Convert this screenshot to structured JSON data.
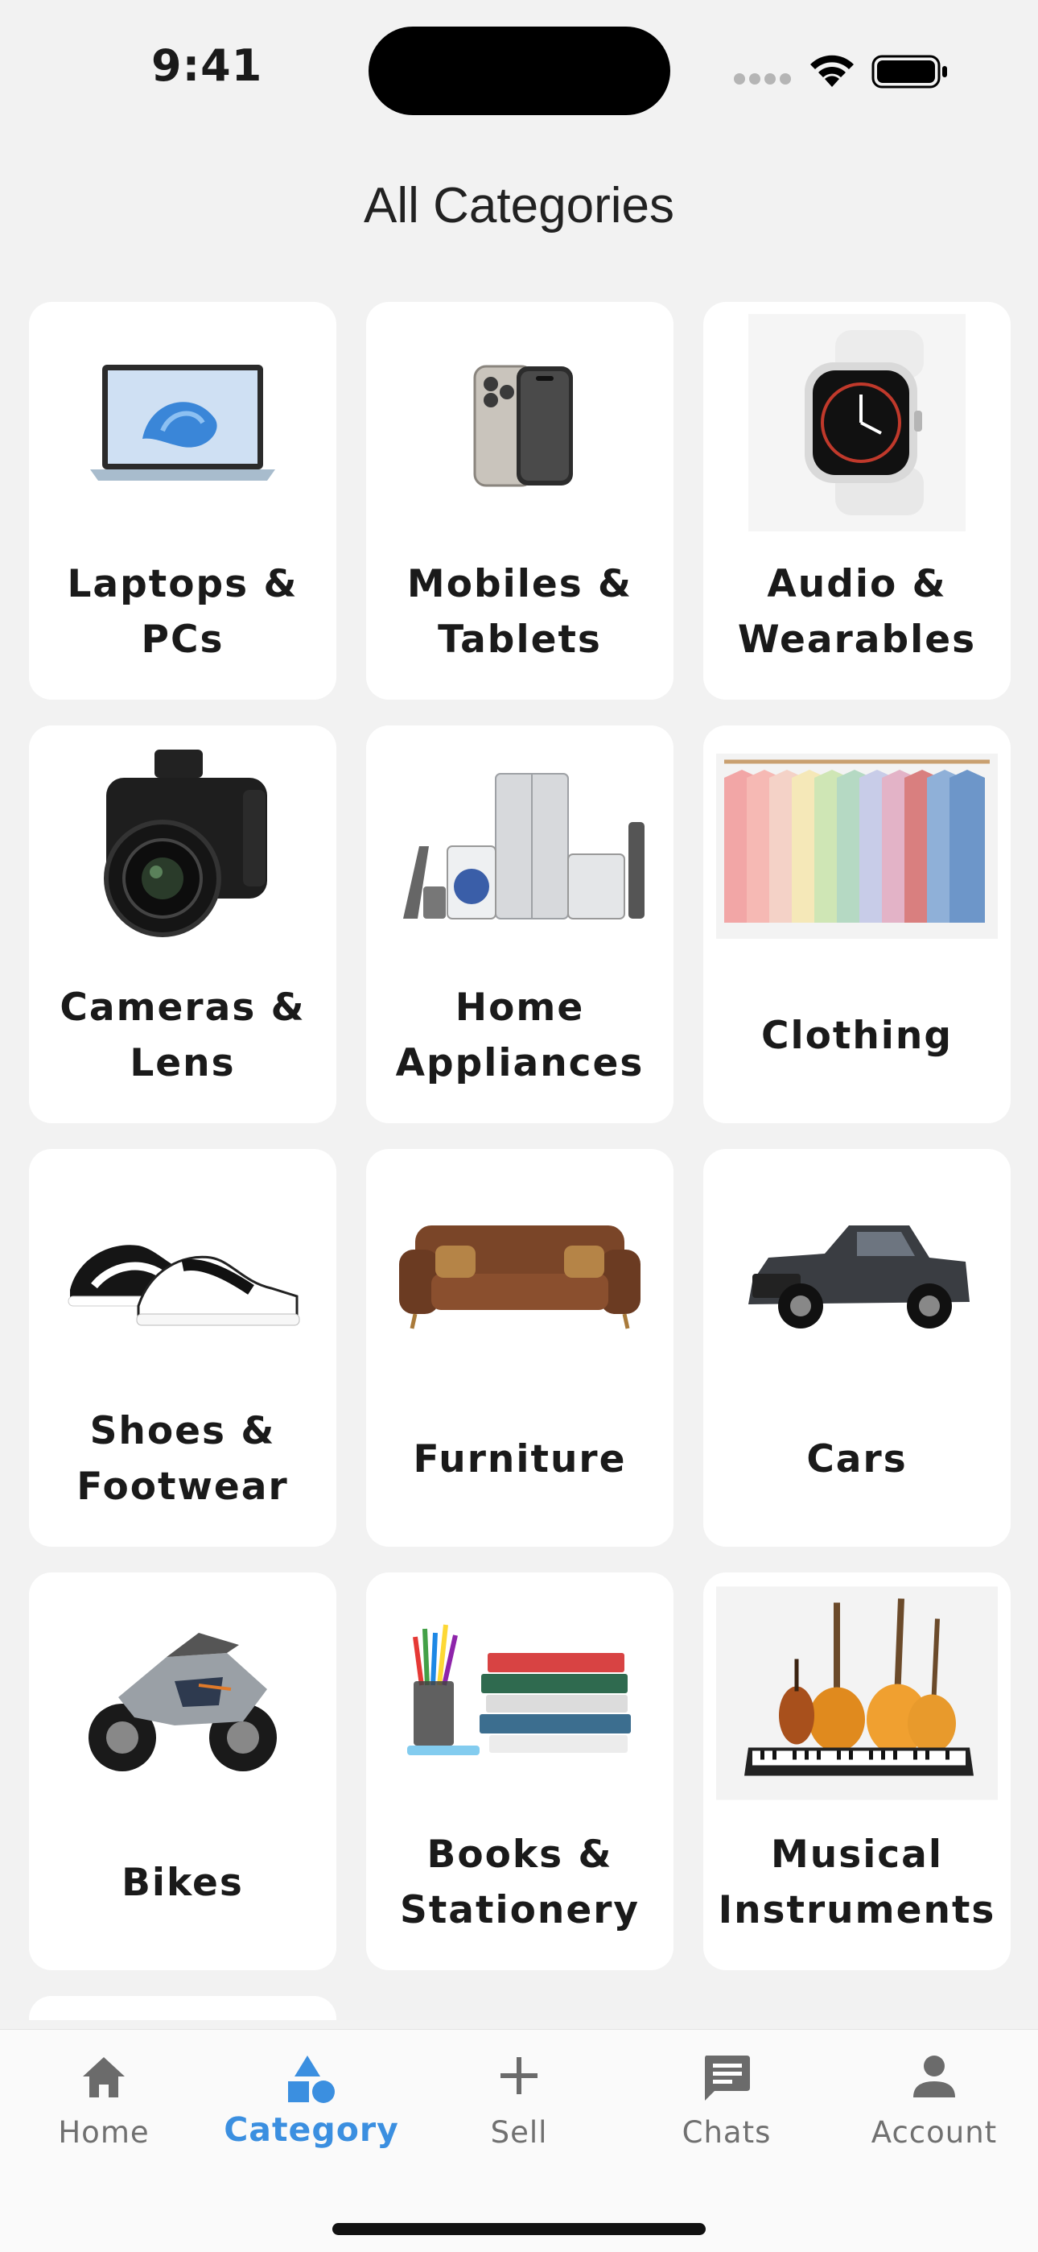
{
  "status_bar": {
    "time": "9:41"
  },
  "header": {
    "title": "All Categories"
  },
  "categories": [
    {
      "label": "Laptops &\nPCs",
      "icon": "laptop-icon"
    },
    {
      "label": "Mobiles &\nTablets",
      "icon": "smartphone-icon"
    },
    {
      "label": "Audio &\nWearables",
      "icon": "smartwatch-icon"
    },
    {
      "label": "Cameras &\nLens",
      "icon": "camera-icon"
    },
    {
      "label": "Home\nAppliances",
      "icon": "appliances-icon"
    },
    {
      "label": "Clothing",
      "icon": "clothing-rack-icon"
    },
    {
      "label": "Shoes &\nFootwear",
      "icon": "sneakers-icon"
    },
    {
      "label": "Furniture",
      "icon": "sofa-icon"
    },
    {
      "label": "Cars",
      "icon": "pickup-truck-icon"
    },
    {
      "label": "Bikes",
      "icon": "motorcycle-icon"
    },
    {
      "label": "Books &\nStationery",
      "icon": "books-icon"
    },
    {
      "label": "Musical\nInstruments",
      "icon": "instruments-icon"
    }
  ],
  "tab_bar": {
    "tabs": [
      {
        "label": "Home",
        "icon": "home-icon"
      },
      {
        "label": "Category",
        "icon": "category-shapes-icon",
        "active": true
      },
      {
        "label": "Sell",
        "icon": "plus-icon"
      },
      {
        "label": "Chats",
        "icon": "chat-bubble-icon"
      },
      {
        "label": "Account",
        "icon": "person-icon"
      }
    ]
  },
  "colors": {
    "accent": "#3b8fe0",
    "background": "#f2f2f2",
    "card": "#ffffff",
    "inactive_tab": "#707070"
  }
}
